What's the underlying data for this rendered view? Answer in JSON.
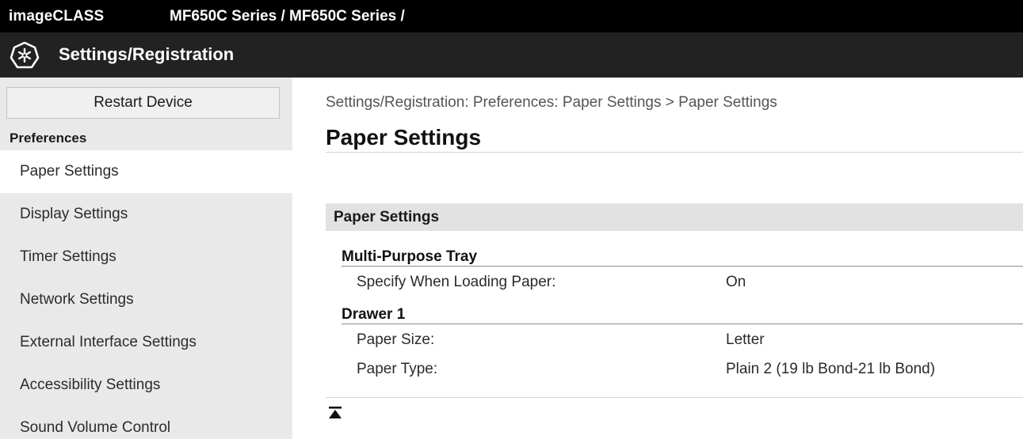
{
  "header": {
    "brand": "imageCLASS",
    "model_path": "MF650C Series / MF650C Series /"
  },
  "titlebar": {
    "title": "Settings/Registration",
    "icon": "settings-registration-icon"
  },
  "sidebar": {
    "restart_label": "Restart Device",
    "heading": "Preferences",
    "items": [
      {
        "label": "Paper Settings",
        "active": true
      },
      {
        "label": "Display Settings"
      },
      {
        "label": "Timer Settings"
      },
      {
        "label": "Network Settings"
      },
      {
        "label": "External Interface Settings"
      },
      {
        "label": "Accessibility Settings"
      },
      {
        "label": "Sound Volume Control"
      }
    ]
  },
  "main": {
    "breadcrumb": "Settings/Registration: Preferences: Paper Settings > Paper Settings",
    "title": "Paper Settings",
    "section": "Paper Settings",
    "groups": [
      {
        "title": "Multi-Purpose Tray",
        "rows": [
          {
            "label": "Specify When Loading Paper:",
            "value": "On"
          }
        ]
      },
      {
        "title": "Drawer 1",
        "rows": [
          {
            "label": "Paper Size:",
            "value": "Letter"
          },
          {
            "label": "Paper Type:",
            "value": "Plain 2 (19 lb Bond-21 lb Bond)"
          }
        ]
      }
    ],
    "top_icon": "back-to-top-icon"
  },
  "colors": {
    "topbar": "#000000",
    "titlebar": "#222222",
    "sidebar": "#e9e9e9",
    "section_header": "#e2e2e2"
  }
}
